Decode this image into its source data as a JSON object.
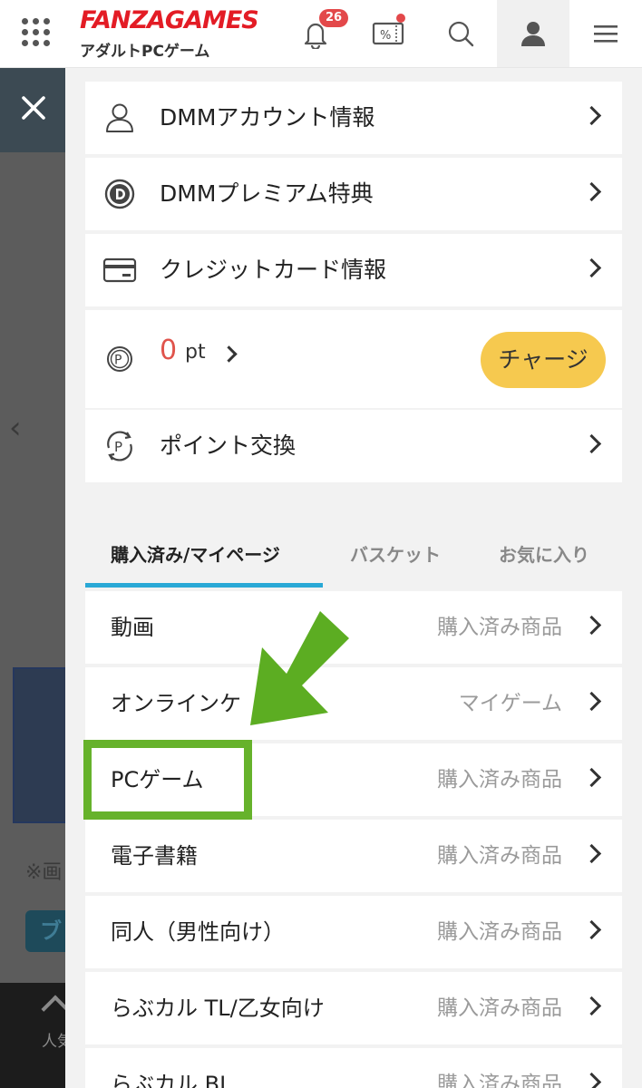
{
  "header": {
    "logo_main": "FANZAGAMES",
    "logo_sub": "アダルトPCゲーム",
    "notification_count": "26",
    "brand_color": "#e31c25",
    "icons": [
      "grid-menu-icon",
      "bell-icon",
      "coupon-icon",
      "search-icon",
      "user-icon",
      "hamburger-icon"
    ]
  },
  "background_page": {
    "note": "※画",
    "tag": "ブ",
    "bottom_label": "人気"
  },
  "account_menu": [
    {
      "label": "DMMアカウント情報",
      "icon": "user-outline-icon"
    },
    {
      "label": "DMMプレミアム特典",
      "icon": "d-coin-icon"
    },
    {
      "label": "クレジットカード情報",
      "icon": "credit-card-icon"
    }
  ],
  "points": {
    "value": "0",
    "unit": "pt",
    "charge_label": "チャージ",
    "charge_color": "#f6c94f"
  },
  "point_exchange": {
    "label": "ポイント交換",
    "icon": "point-exchange-icon"
  },
  "tabs": [
    {
      "label": "購入済み/マイページ",
      "active": true
    },
    {
      "label": "バスケット",
      "active": false
    },
    {
      "label": "お気に入り",
      "active": false
    }
  ],
  "tab_accent": "#29a8d6",
  "purchases": [
    {
      "label": "動画",
      "sub": "購入済み商品"
    },
    {
      "label": "オンラインケ",
      "sub": "マイゲーム"
    },
    {
      "label": "PCゲーム",
      "sub": "購入済み商品"
    },
    {
      "label": "電子書籍",
      "sub": "購入済み商品"
    },
    {
      "label": "同人（男性向け）",
      "sub": "購入済み商品"
    },
    {
      "label": "らぶカル TL/乙女向け",
      "sub": "購入済み商品"
    },
    {
      "label": "らぶカル BL",
      "sub": "購入済み商品"
    }
  ],
  "annotation": {
    "highlight_color": "#66b22b",
    "arrow_color": "#5cad22"
  }
}
